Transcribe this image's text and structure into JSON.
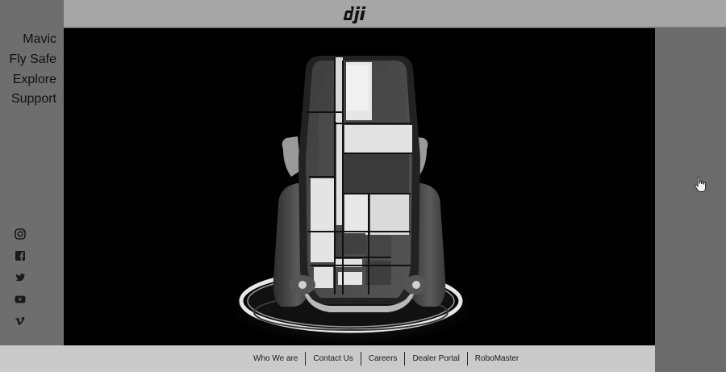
{
  "brand": {
    "logo_text": "dji"
  },
  "sidebar": {
    "nav": [
      {
        "label": "Mavic"
      },
      {
        "label": "Fly Safe"
      },
      {
        "label": "Explore"
      },
      {
        "label": "Support"
      }
    ],
    "social": [
      "instagram-icon",
      "facebook-icon",
      "twitter-icon",
      "youtube-icon",
      "vimeo-icon"
    ]
  },
  "footer": {
    "links": [
      {
        "label": "Who We are"
      },
      {
        "label": "Contact Us"
      },
      {
        "label": "Careers"
      },
      {
        "label": "Dealer Portal"
      },
      {
        "label": "RoboMaster"
      }
    ]
  },
  "colors": {
    "sidebar_bg": "#6e6e6e",
    "header_bg": "#a6a6a6",
    "stage_bg": "#000000",
    "footer_bg": "#cacaca"
  }
}
